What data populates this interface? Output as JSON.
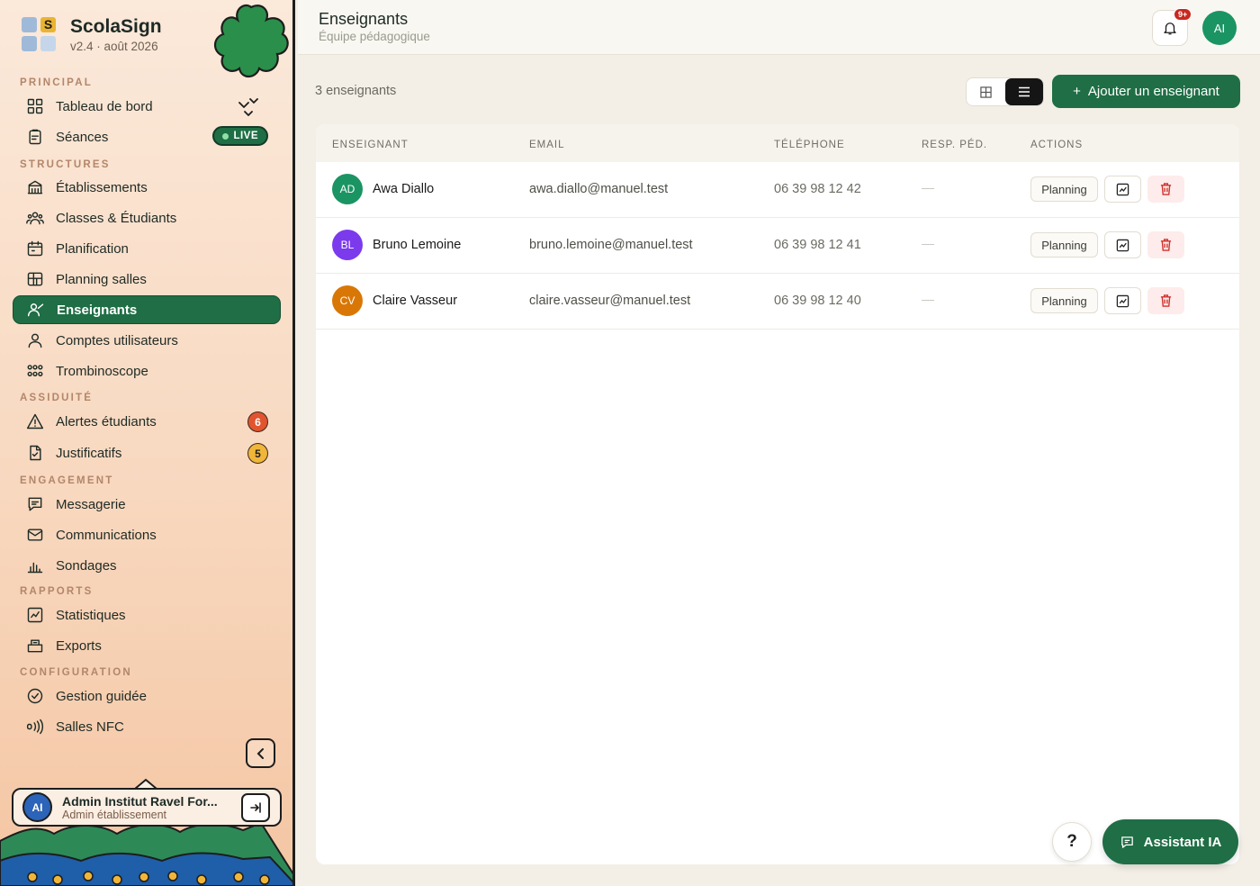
{
  "brand": {
    "name": "ScolaSign",
    "version": "v2.4 · août 2026",
    "logo_letter": "S"
  },
  "sidebar": {
    "sections": {
      "principal": "PRINCIPAL",
      "structures": "STRUCTURES",
      "assiduite": "ASSIDUITÉ",
      "engagement": "ENGAGEMENT",
      "rapports": "RAPPORTS",
      "configuration": "CONFIGURATION"
    },
    "items": {
      "tableau": "Tableau de bord",
      "seances": "Séances",
      "etablissements": "Établissements",
      "classes": "Classes & Étudiants",
      "planification": "Planification",
      "planning_salles": "Planning salles",
      "enseignants": "Enseignants",
      "comptes": "Comptes utilisateurs",
      "trombinoscope": "Trombinoscope",
      "alertes": "Alertes étudiants",
      "justificatifs": "Justificatifs",
      "messagerie": "Messagerie",
      "communications": "Communications",
      "sondages": "Sondages",
      "statistiques": "Statistiques",
      "exports": "Exports",
      "gestion_guidee": "Gestion guidée",
      "salles_nfc": "Salles NFC"
    },
    "live_label": "LIVE",
    "alertes_count": "6",
    "justificatifs_count": "5",
    "user": {
      "initials": "AI",
      "name": "Admin Institut Ravel For...",
      "role": "Admin établissement"
    }
  },
  "header": {
    "title": "Enseignants",
    "subtitle": "Équipe pédagogique",
    "notif_count": "9+",
    "avatar_initials": "AI"
  },
  "toolbar": {
    "count_label": "3 enseignants",
    "add_label": "Ajouter un enseignant",
    "add_prefix": "+"
  },
  "table": {
    "headers": {
      "enseignant": "ENSEIGNANT",
      "email": "EMAIL",
      "telephone": "TÉLÉPHONE",
      "resp": "RESP. PÉD.",
      "actions": "ACTIONS"
    },
    "rows": [
      {
        "initials": "AD",
        "name": "Awa Diallo",
        "email": "awa.diallo@manuel.test",
        "phone": "06 39 98 12 42",
        "resp": "—",
        "color": "#1a9463",
        "planning": "Planning"
      },
      {
        "initials": "BL",
        "name": "Bruno Lemoine",
        "email": "bruno.lemoine@manuel.test",
        "phone": "06 39 98 12 41",
        "resp": "—",
        "color": "#7c3aed",
        "planning": "Planning"
      },
      {
        "initials": "CV",
        "name": "Claire Vasseur",
        "email": "claire.vasseur@manuel.test",
        "phone": "06 39 98 12 40",
        "resp": "—",
        "color": "#d97706",
        "planning": "Planning"
      }
    ]
  },
  "fab": {
    "help": "?",
    "assistant": "Assistant IA"
  },
  "colors": {
    "primary": "#1f6e45",
    "danger": "#c8281f",
    "sidebar_bg": "#f8d8bf"
  }
}
